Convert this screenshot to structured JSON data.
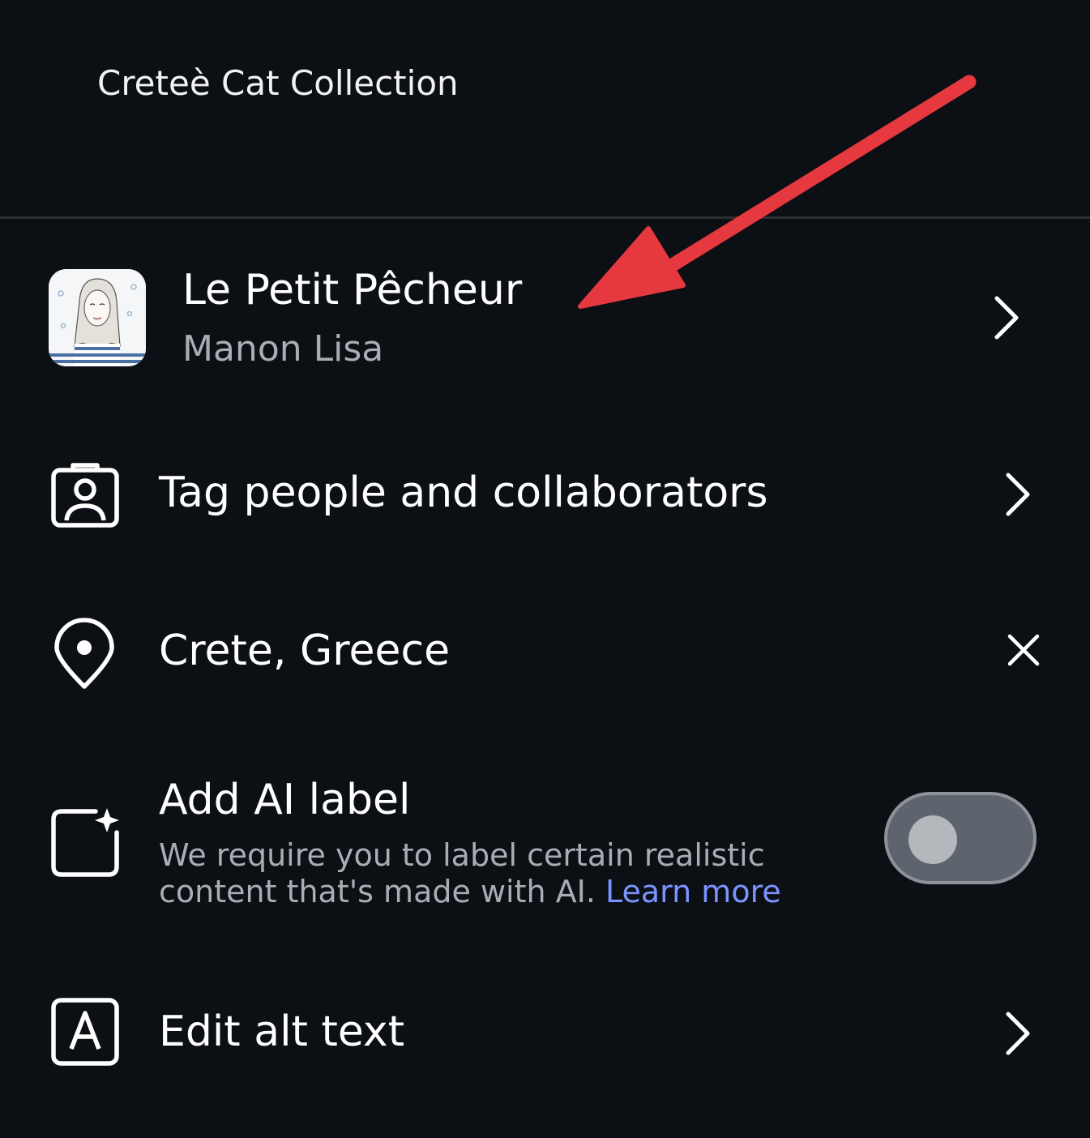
{
  "caption": {
    "text": "Creteè Cat Collection"
  },
  "music": {
    "title": "Le Petit Pêcheur",
    "artist": "Manon Lisa",
    "icon": "chevron-right-icon"
  },
  "tag": {
    "label": "Tag people and collaborators",
    "icon": "person-badge-icon"
  },
  "location": {
    "label": "Crete, Greece",
    "icon": "location-pin-icon",
    "clear_icon": "close-icon"
  },
  "ai_label": {
    "title": "Add AI label",
    "description": "We require you to label certain realistic content that's made with AI.",
    "link": "Learn more",
    "toggle_on": false,
    "icon": "ai-sparkle-square-icon"
  },
  "alt_text": {
    "label": "Edit alt text",
    "icon": "alt-text-icon"
  },
  "colors": {
    "background": "#0c0f14",
    "link": "#7c94ff",
    "annotation_arrow": "#e5383f",
    "toggle_off": "#5d646d"
  }
}
